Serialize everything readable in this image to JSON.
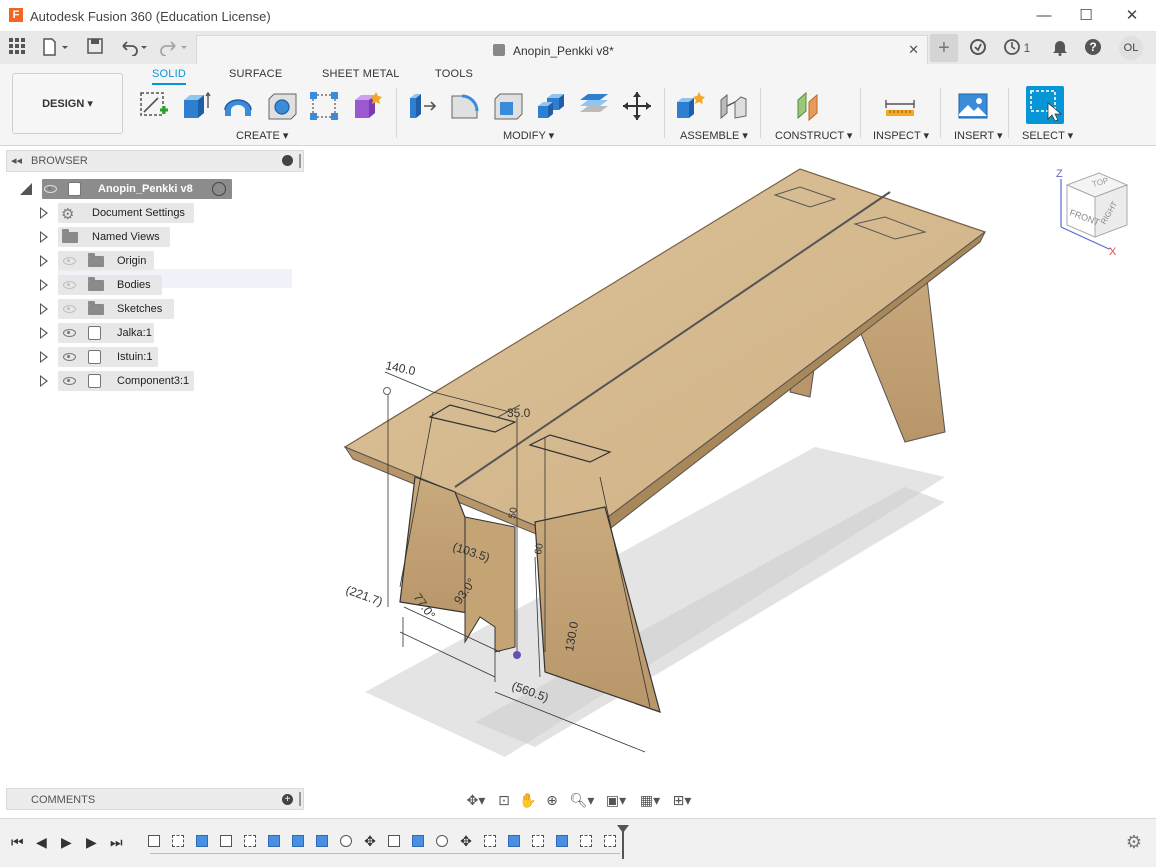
{
  "window": {
    "title": "Autodesk Fusion 360 (Education License)",
    "logo_letter": "F",
    "minimize": "—",
    "maximize": "☐",
    "close": "✕"
  },
  "tabbar": {
    "doc_tab_label": "Anopin_Penkki v8*",
    "job_count": "1",
    "user_initials": "OL"
  },
  "ribbon": {
    "workspace_label": "DESIGN",
    "tabs": [
      "SOLID",
      "SURFACE",
      "SHEET METAL",
      "TOOLS"
    ],
    "groups": {
      "create": "CREATE",
      "modify": "MODIFY",
      "assemble": "ASSEMBLE",
      "construct": "CONSTRUCT",
      "inspect": "INSPECT",
      "insert": "INSERT",
      "select": "SELECT"
    }
  },
  "browser": {
    "title": "BROWSER",
    "root": "Anopin_Penkki v8",
    "items": [
      {
        "label": "Document Settings"
      },
      {
        "label": "Named Views"
      },
      {
        "label": "Origin"
      },
      {
        "label": "Bodies"
      },
      {
        "label": "Sketches"
      },
      {
        "label": "Jalka:1"
      },
      {
        "label": "Istuin:1"
      },
      {
        "label": "Component3:1"
      }
    ]
  },
  "comments": {
    "title": "COMMENTS"
  },
  "viewcube": {
    "top": "TOP",
    "front": "FRONT",
    "right": "RIGHT",
    "axis_z": "Z",
    "axis_x": "X"
  },
  "dimensions": {
    "d1": "140.0",
    "d2": "35.0",
    "d3": "(103.5)",
    "d4": "(221.7)",
    "d5": "77.0°",
    "d6": "93.0°",
    "d7": "130.0",
    "d8": "(560.5)",
    "d9": "50",
    "d10": "60"
  },
  "colors": {
    "accent": "#0696d7",
    "wood": "#d2b48c",
    "wood_dark": "#b8966a"
  }
}
